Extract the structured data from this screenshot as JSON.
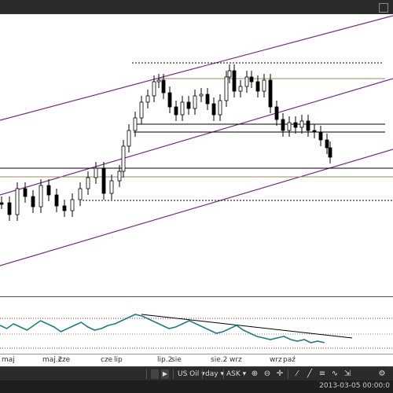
{
  "x_axis": {
    "labels": [
      "maj",
      "maj.2",
      "cze",
      "cze",
      "lip",
      "lip.2",
      "sie",
      "sie.2",
      "wrz",
      "wrz",
      "paź"
    ]
  },
  "toolbar": {
    "symbol": "US Oil",
    "interval": "day",
    "price_type": "ASK"
  },
  "status": {
    "timestamp": "2013-03-05 00:00:0"
  },
  "colors": {
    "channel": "#7a2a8a",
    "indicator": "#1f7d7d",
    "dotted_level": "#cc2222",
    "candle": "#000000"
  },
  "icons": [
    "scroll-right-icon",
    "dropdown-arrow-icon",
    "zoom-in-icon",
    "zoom-out-icon",
    "crosshair-icon",
    "settings-icon"
  ]
}
